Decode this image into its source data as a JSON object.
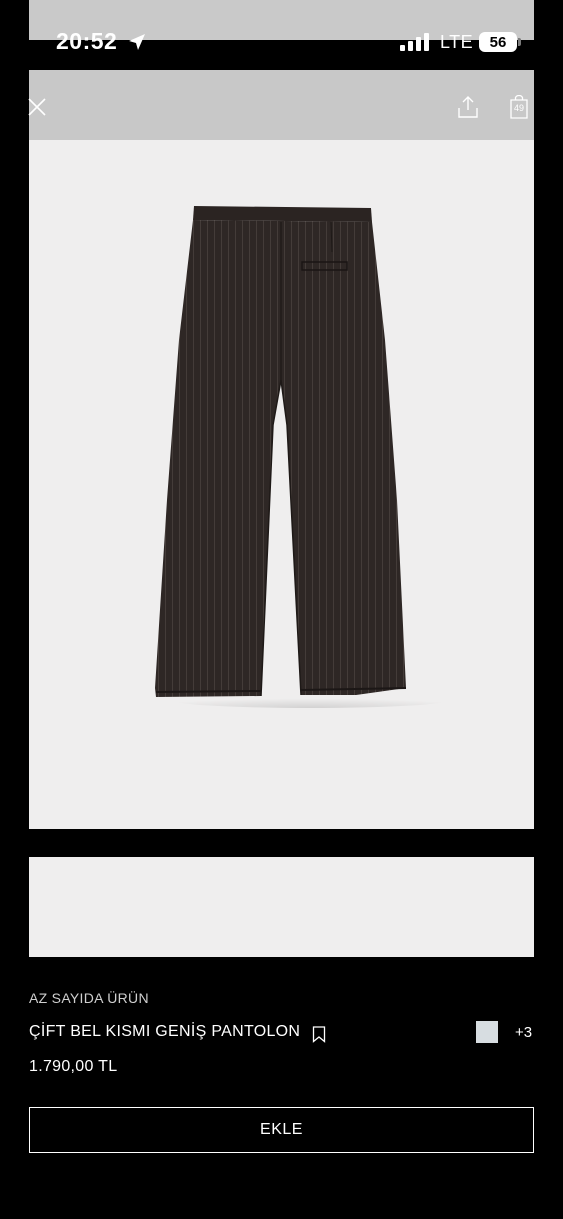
{
  "status_bar": {
    "time": "20:52",
    "network": "LTE",
    "battery": "56"
  },
  "nav": {
    "icons": [
      "close-icon",
      "share-icon",
      "shopping-bag-icon"
    ],
    "bag_count": "49"
  },
  "product": {
    "stock_note": "AZ SAYIDA ÜRÜN",
    "name": "ÇİFT BEL KISMI GENİŞ PANTOLON",
    "price": "1.790,00 TL",
    "more_colors": "+3",
    "swatch_color": "#d7dde1",
    "garment_color": "#2e2725"
  },
  "actions": {
    "add_label": "EKLE"
  }
}
